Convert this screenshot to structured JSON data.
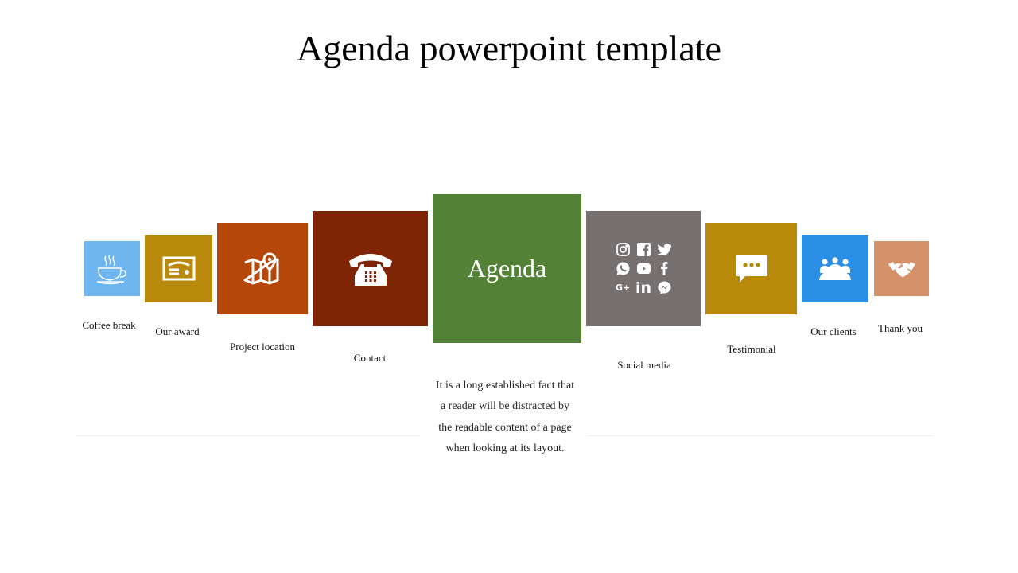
{
  "slide": {
    "title": "Agenda powerpoint template"
  },
  "center": {
    "title": "Agenda",
    "color": "#538135",
    "description": "It is a long established fact that a reader will be distracted by the readable content of a page when looking at its layout."
  },
  "items": [
    {
      "label": "Coffee break",
      "icon": "coffee-cup-icon",
      "color": "#6fb5f0"
    },
    {
      "label": "Our award",
      "icon": "certificate-icon",
      "color": "#b8890a"
    },
    {
      "label": "Project  location",
      "icon": "map-pin-icon",
      "color": "#b5470a"
    },
    {
      "label": "Contact",
      "icon": "telephone-icon",
      "color": "#7f2404"
    },
    {
      "label": "Social media",
      "icon": "social-media-icons",
      "color": "#767170"
    },
    {
      "label": "Testimonial",
      "icon": "speech-bubble-icon",
      "color": "#b8890a"
    },
    {
      "label": "Our clients",
      "icon": "group-meeting-icon",
      "color": "#2b8fe6"
    },
    {
      "label": "Thank you",
      "icon": "handshake-icon",
      "color": "#d5916a"
    }
  ],
  "social_icons": [
    "instagram-icon",
    "facebook-square-icon",
    "twitter-icon",
    "whatsapp-icon",
    "youtube-icon",
    "facebook-icon",
    "google-plus-icon",
    "linkedin-icon",
    "messenger-icon"
  ],
  "google_plus_text": "G+",
  "linkedin_text": "in"
}
